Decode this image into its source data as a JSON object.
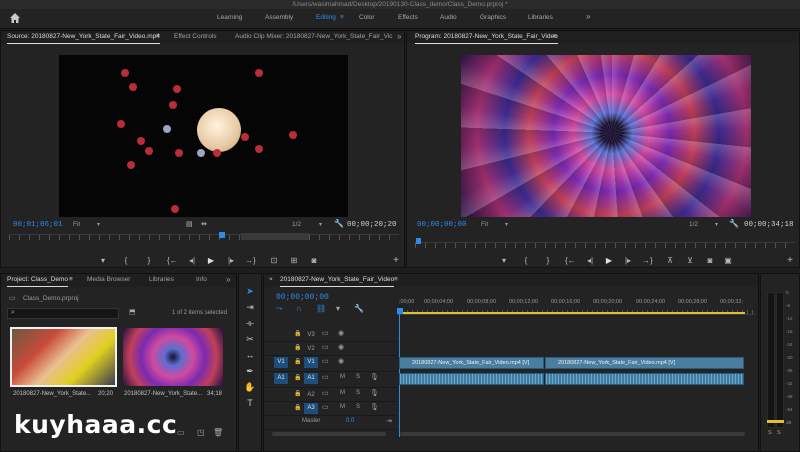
{
  "window_title": "/Users/wasimahmad/Desktop/20190130-Class_demo/Class_Demo.prproj *",
  "workspaces": [
    "Learning",
    "Assembly",
    "Editing",
    "Color",
    "Effects",
    "Audio",
    "Graphics",
    "Libraries"
  ],
  "workspace_more": "»",
  "source": {
    "tabs": [
      "Source: 20180827-New_York_State_Fair_Video.mp4",
      "Effect Controls",
      "Audio Clip Mixer: 20180827-New_York_State_Fair_Vic"
    ],
    "tabs_more": "»",
    "timecode": "00;01;06;01",
    "fit": "Fit",
    "resolution": "1/2",
    "duration": "00;00;20;20"
  },
  "program": {
    "tab": "Program: 20180827-New_York_State_Fair_Video",
    "timecode": "00;00;00;00",
    "fit": "Fit",
    "resolution": "1/2",
    "duration": "00;00;34;18"
  },
  "project": {
    "tabs": [
      "Project: Class_Demo",
      "Media Browser",
      "Libraries",
      "Info"
    ],
    "tabs_more": "»",
    "file": "Class_Demo.prproj",
    "search_placeholder": "",
    "selected": "1 of 2 items selected",
    "items": [
      {
        "name": "20180827-New_York_State...",
        "duration": "20;20"
      },
      {
        "name": "20180827-New_York_State...",
        "duration": "34;18"
      }
    ]
  },
  "timeline": {
    "tab": "20180827-New_York_State_Fair_Video",
    "timecode": "00;00;00;00",
    "ruler_ticks": [
      ";00;00",
      "00;00;04;00",
      "00;00;08;00",
      "00;00;12;00",
      "00;00;16;00",
      "00;00;20;00",
      "00;00;24;00",
      "00;00;28;00",
      "00;00;32;"
    ],
    "video_tracks": [
      {
        "target": "",
        "name": "V3"
      },
      {
        "target": "",
        "name": "V2"
      },
      {
        "target": "V1",
        "name": "V1"
      }
    ],
    "audio_tracks": [
      {
        "target": "A1",
        "name": "A1",
        "m": "M",
        "s": "S"
      },
      {
        "target": "",
        "name": "A2",
        "m": "M",
        "s": "S"
      },
      {
        "target": "",
        "name": "A3",
        "m": "M",
        "s": "S"
      }
    ],
    "master_label": "Master",
    "master_value": "0.0",
    "clips": [
      "20180827-New_York_State_Fair_Video.mp4 [V]",
      "20180827-New_York_State_Fair_Video.mp4 [V]"
    ]
  },
  "meter": {
    "scale": [
      "0",
      "-6",
      "-12",
      "-18",
      "-24",
      "-30",
      "-36",
      "-42",
      "-48",
      "-54",
      "dB"
    ],
    "s1": "S",
    "s2": "S"
  },
  "watermark": "kuyhaaa.cc",
  "colors": {
    "accent": "#2d8ceb",
    "panel": "#232323",
    "clip_video": "#4a7ea0",
    "clip_audio": "#3e7da5"
  }
}
